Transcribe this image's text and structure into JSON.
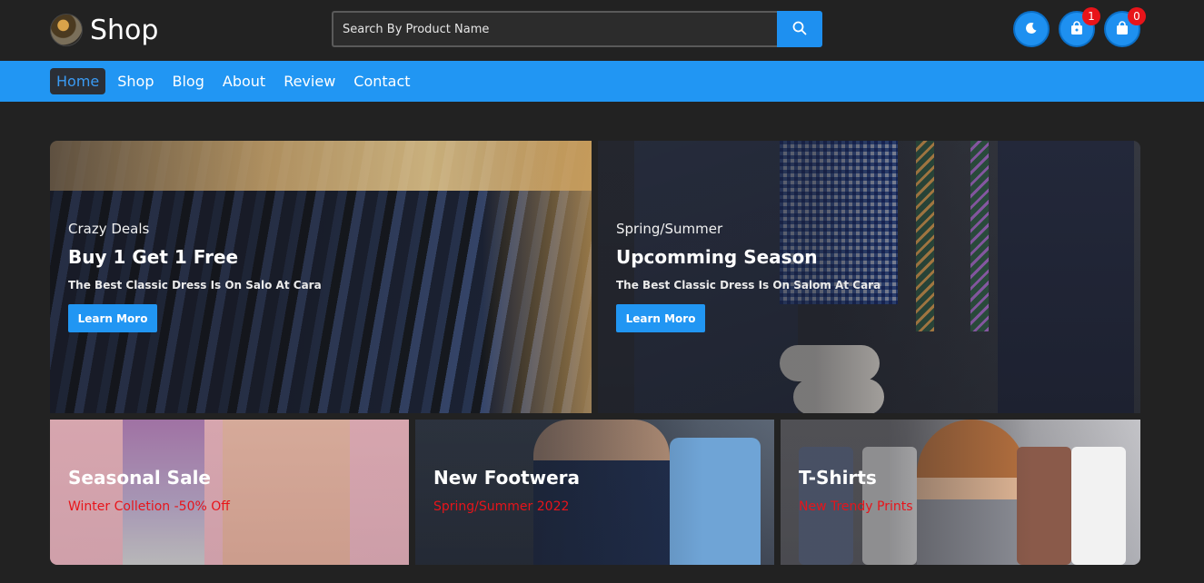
{
  "header": {
    "logo_text": "Shop",
    "search_placeholder": "Search By Product Name",
    "icons": [
      "moon-icon",
      "bag-icon",
      "cart-icon"
    ],
    "wishlist_count": "1",
    "cart_count": "0",
    "accent_color": "#1e90f0",
    "badge_color": "#e8141a"
  },
  "nav": {
    "items": [
      "Home",
      "Shop",
      "Blog",
      "About",
      "Review",
      "Contact"
    ],
    "active": "Home"
  },
  "banners": {
    "crazy_deals": {
      "eyebrow": "Crazy Deals",
      "headline": "Buy 1 Get 1 Free",
      "description": "The Best Classic Dress Is On Salo At Cara",
      "button": "Learn Moro"
    },
    "upcoming_season": {
      "eyebrow": "Spring/Summer",
      "headline": "Upcomming Season",
      "description": "The Best Classic Dress Is On Salom At Cara",
      "button": "Learn Moro"
    },
    "seasonal_sale": {
      "title": "Seasonal Sale",
      "subtitle": "Winter Colletion -50% Off"
    },
    "new_footwear": {
      "title": "New Footwera",
      "subtitle": "Spring/Summer 2022"
    },
    "t_shirts": {
      "title": "T-Shirts",
      "subtitle": "New Trendy Prints"
    }
  }
}
